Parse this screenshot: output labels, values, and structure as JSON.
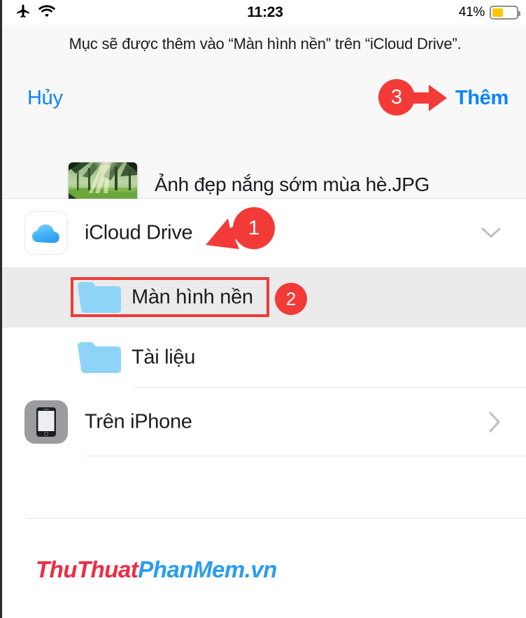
{
  "status_bar": {
    "airplane_icon": "airplane-mode-icon",
    "wifi_icon": "wifi-icon",
    "time": "11:23",
    "battery_percent": "41%",
    "battery_level": 41,
    "battery_color": "#fdc500"
  },
  "sheet": {
    "prompt": "Mục sẽ được thêm vào “Màn hình nền” trên “iCloud Drive”.",
    "cancel_label": "Hủy",
    "add_label": "Thêm",
    "accent_color": "#0a84ff",
    "file": {
      "name": "Ảnh đẹp nắng sớm mùa hè.JPG",
      "thumbnail": "forest-sunrays-photo"
    }
  },
  "list": {
    "rows": [
      {
        "label": "iCloud Drive",
        "icon": "icloud-drive-icon",
        "accessory": "chevron-down-icon",
        "selected": false
      },
      {
        "label": "Màn hình nền",
        "icon": "folder-icon",
        "accessory": "",
        "selected": true
      },
      {
        "label": "Tài liệu",
        "icon": "folder-icon",
        "accessory": "",
        "selected": false
      },
      {
        "label": "Trên iPhone",
        "icon": "iphone-device-icon",
        "accessory": "chevron-right-icon",
        "selected": false
      }
    ]
  },
  "annotations": {
    "step1": "1",
    "step2": "2",
    "step3": "3",
    "color": "#f23b37"
  },
  "watermark": {
    "part1": "ThuThuat",
    "part2": "PhanMem.vn",
    "color1": "#ec2b45",
    "color2": "#2a9cf0"
  }
}
